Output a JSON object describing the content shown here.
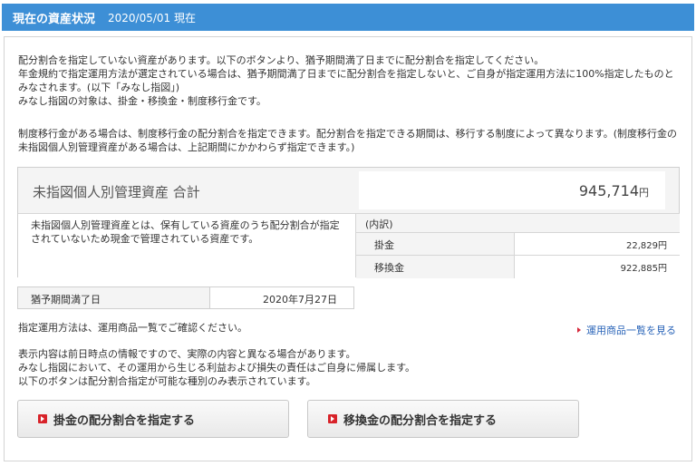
{
  "header": {
    "title": "現在の資産状況",
    "date": "2020/05/01 現在"
  },
  "intro": {
    "line1": "配分割合を指定していない資産があります。以下のボタンより、猶予期間満了日までに配分割合を指定してください。",
    "line2": "年金規約で指定運用方法が選定されている場合は、猶予期間満了日までに配分割合を指定しないと、ご自身が指定運用方法に100%指定したものとみなされます。(以下「みなし指図」)",
    "line3": "みなし指図の対象は、掛金・移換金・制度移行金です。"
  },
  "transition_note": "制度移行金がある場合は、制度移行金の配分割合を指定できます。配分割合を指定できる期間は、移行する制度によって異なります。(制度移行金の未指図個人別管理資産がある場合は、上記期間にかかわらず指定できます。)",
  "summary": {
    "label": "未指図個人別管理資産 合計",
    "total": "945,714",
    "unit": "円",
    "description": "未指図個人別管理資産とは、保有している資産のうち配分割合が指定されていないため現金で管理されている資産です。",
    "breakdown_title": "(内訳)",
    "breakdown": [
      {
        "name": "掛金",
        "value": "22,829円"
      },
      {
        "name": "移換金",
        "value": "922,885円"
      }
    ]
  },
  "deadline": {
    "label": "猶予期間満了日",
    "value": "2020年7月27日"
  },
  "method_note": "指定運用方法は、運用商品一覧でご確認ください。",
  "products_link": "運用商品一覧を見る",
  "disclaimer": {
    "line1": "表示内容は前日時点の情報ですので、実際の内容と異なる場合があります。",
    "line2": "みなし指図において、その運用から生じる利益および損失の責任はご自身に帰属します。",
    "line3": "以下のボタンは配分割合指定が可能な種別のみ表示されています。"
  },
  "buttons": {
    "contribution": "掛金の配分割合を指定する",
    "transfer": "移換金の配分割合を指定する"
  },
  "colors": {
    "header_bg": "#3d8fd6",
    "link": "#2a64b8",
    "accent_red": "#d8232a"
  }
}
